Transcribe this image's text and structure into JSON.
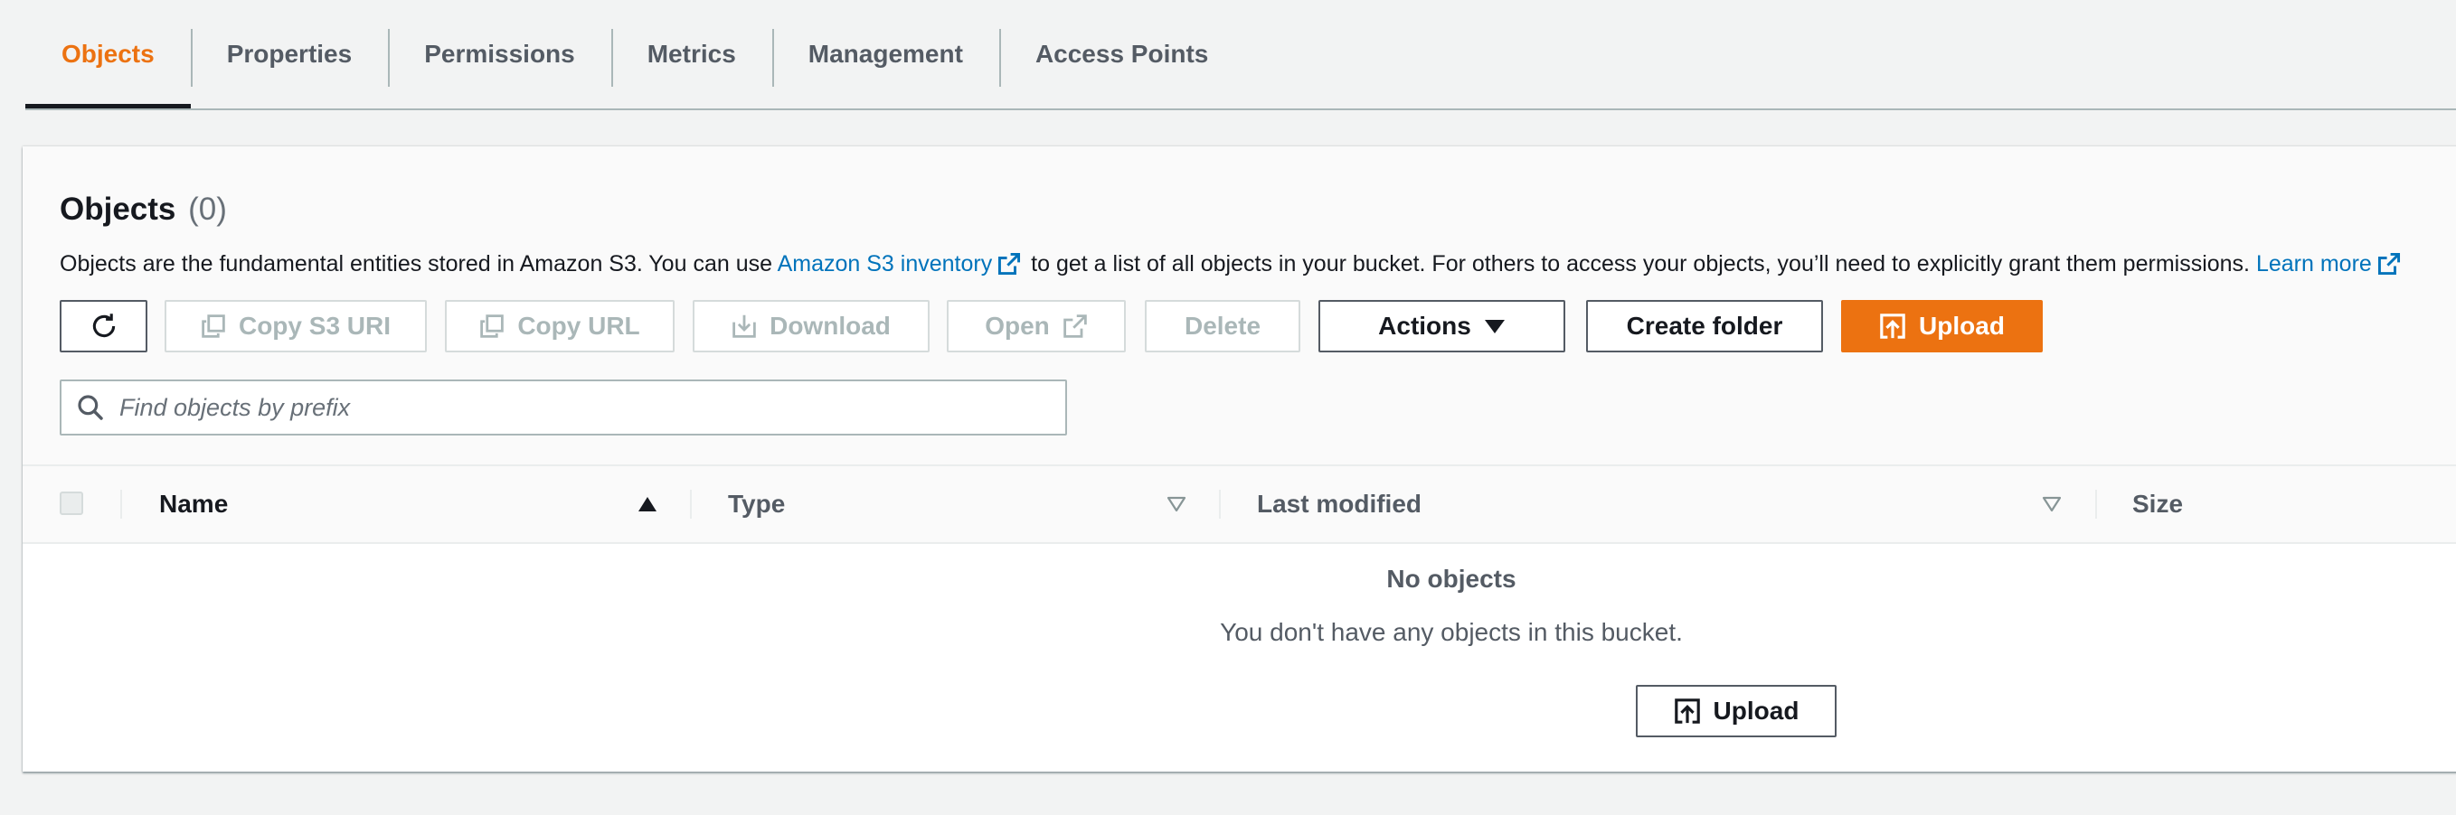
{
  "tabs": [
    {
      "label": "Objects",
      "active": true
    },
    {
      "label": "Properties",
      "active": false
    },
    {
      "label": "Permissions",
      "active": false
    },
    {
      "label": "Metrics",
      "active": false
    },
    {
      "label": "Management",
      "active": false
    },
    {
      "label": "Access Points",
      "active": false
    }
  ],
  "objects_panel": {
    "title": "Objects",
    "count": "(0)",
    "description_before": "Objects are the fundamental entities stored in Amazon S3. You can use ",
    "inventory_link": "Amazon S3 inventory",
    "description_after": " to get a list of all objects in your bucket. For others to access your objects, you’ll need to explicitly grant them permissions. ",
    "learn_more_link": "Learn more"
  },
  "toolbar": {
    "refresh_icon": "refresh-icon",
    "copy_s3_uri": "Copy S3 URI",
    "copy_url": "Copy URL",
    "download": "Download",
    "open": "Open",
    "delete": "Delete",
    "actions": "Actions",
    "create_folder": "Create folder",
    "upload": "Upload"
  },
  "search": {
    "placeholder": "Find objects by prefix",
    "value": ""
  },
  "table": {
    "columns": [
      {
        "label": "Name",
        "sort": "ascending"
      },
      {
        "label": "Type",
        "sort": "none"
      },
      {
        "label": "Last modified",
        "sort": "none"
      },
      {
        "label": "Size",
        "sort": "none"
      }
    ],
    "rows": []
  },
  "empty_state": {
    "title": "No objects",
    "description": "You don't have any objects in this bucket.",
    "upload_label": "Upload"
  },
  "colors": {
    "accent": "#ec7211",
    "link": "#0073bb",
    "text": "#16191f",
    "muted": "#545b64",
    "disabled": "#aab7b8",
    "background": "#f2f3f3"
  }
}
